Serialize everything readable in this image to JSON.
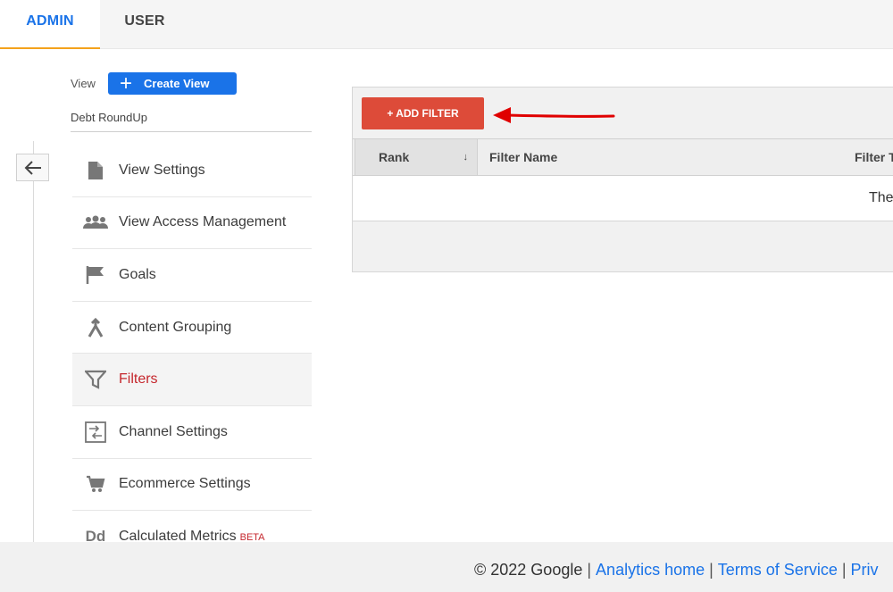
{
  "tabs": [
    {
      "label": "ADMIN",
      "active": true
    },
    {
      "label": "USER",
      "active": false
    }
  ],
  "view": {
    "label": "View",
    "create_button": "Create View",
    "selected": "Debt RoundUp"
  },
  "menu": {
    "items": [
      {
        "label": "View Settings",
        "icon": "document-icon"
      },
      {
        "label": "View Access Management",
        "icon": "people-icon"
      },
      {
        "label": "Goals",
        "icon": "flag-icon"
      },
      {
        "label": "Content Grouping",
        "icon": "merge-icon"
      },
      {
        "label": "Filters",
        "icon": "filter-icon",
        "active": true
      },
      {
        "label": "Channel Settings",
        "icon": "channel-icon"
      },
      {
        "label": "Ecommerce Settings",
        "icon": "cart-icon"
      },
      {
        "label": "Calculated Metrics",
        "icon": "dd-icon",
        "badge": "BETA"
      }
    ],
    "calculated_icon_text": "Dd"
  },
  "filters": {
    "add_button": "+ ADD FILTER",
    "columns": {
      "rank": "Rank",
      "rank_sort": "↓",
      "name": "Filter Name",
      "type": "Filter T"
    },
    "empty_text": "The"
  },
  "footer": {
    "copyright": "© 2022 Google",
    "links": [
      "Analytics home",
      "Terms of Service",
      "Priv"
    ]
  },
  "colors": {
    "accent_blue": "#1a73e8",
    "add_filter_red": "#dd4b39",
    "active_tab_underline": "#f4a21c",
    "active_menu_text": "#c5272d",
    "annotation_arrow": "#e00000"
  }
}
